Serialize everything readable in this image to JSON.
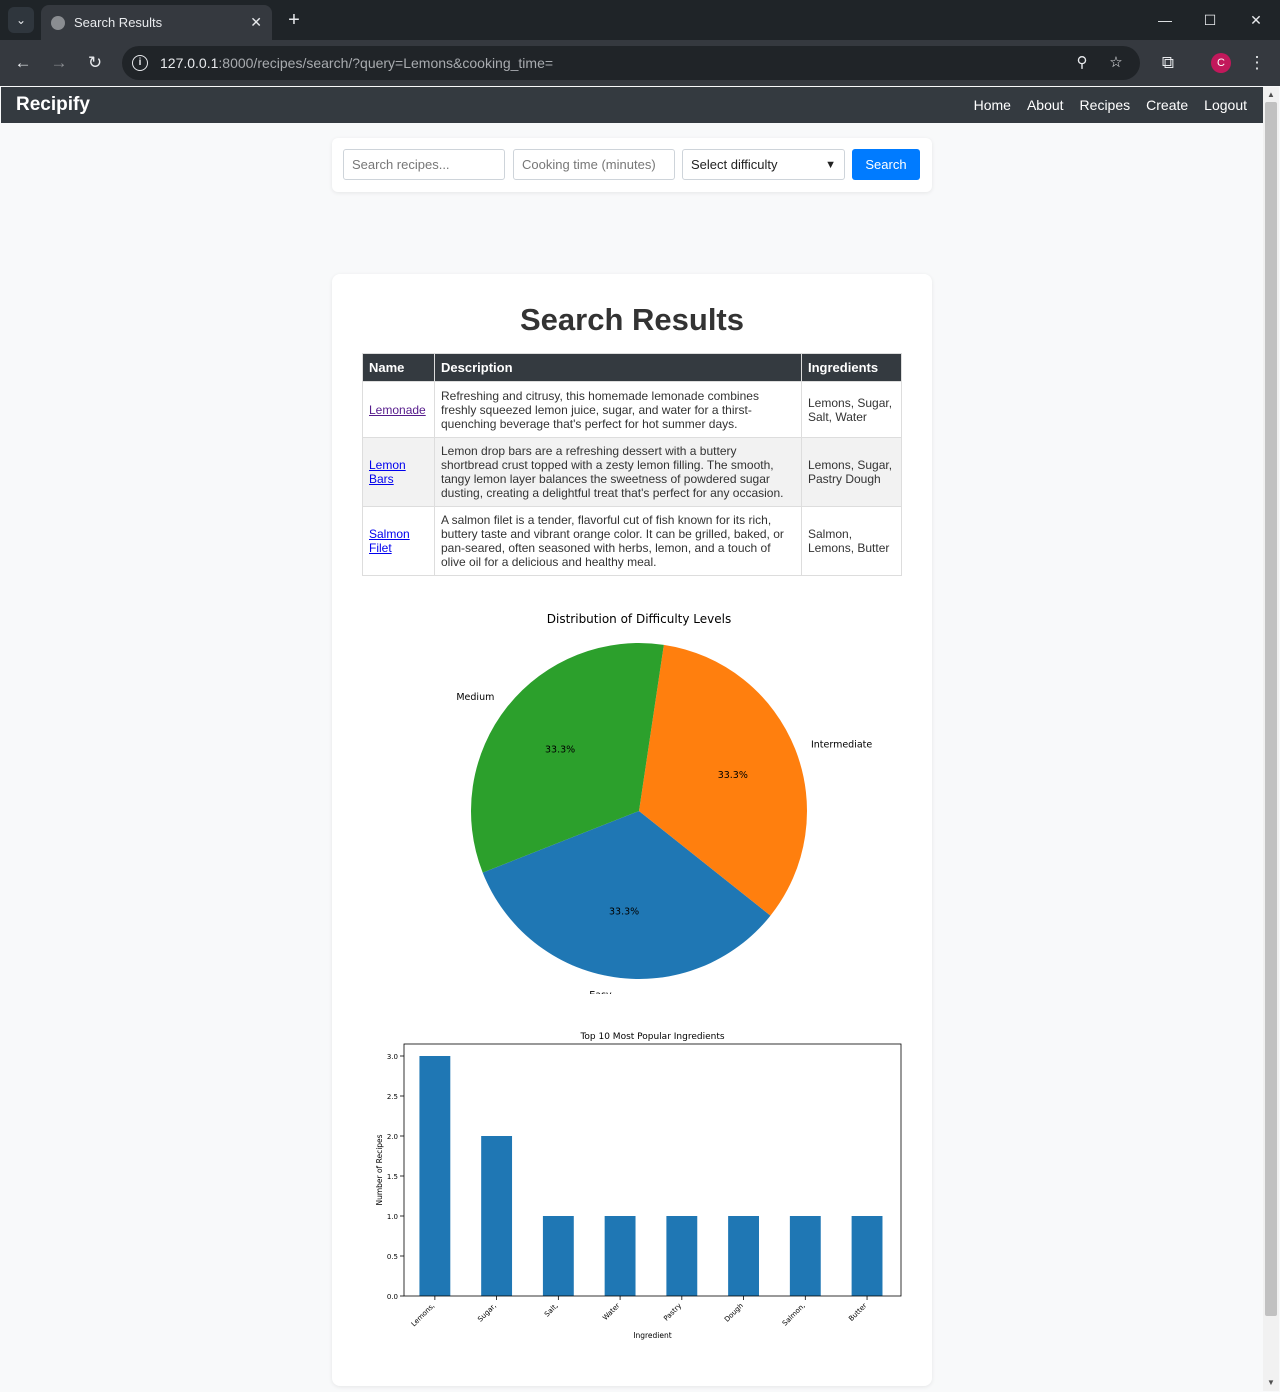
{
  "browser": {
    "tab_title": "Search Results",
    "url_host": "127.0.0.1",
    "url_rest": ":8000/recipes/search/?query=Lemons&cooking_time=",
    "profile_initial": "C"
  },
  "site": {
    "brand": "Recipify",
    "nav": [
      "Home",
      "About",
      "Recipes",
      "Create",
      "Logout"
    ]
  },
  "search": {
    "query_placeholder": "Search recipes...",
    "time_placeholder": "Cooking time (minutes)",
    "difficulty_selected": "Select difficulty",
    "button": "Search"
  },
  "results": {
    "heading": "Search Results",
    "columns": [
      "Name",
      "Description",
      "Ingredients"
    ],
    "rows": [
      {
        "name": "Lemonade",
        "description": "Refreshing and citrusy, this homemade lemonade combines freshly squeezed lemon juice, sugar, and water for a thirst-quenching beverage that's perfect for hot summer days.",
        "ingredients": "Lemons, Sugar, Salt, Water"
      },
      {
        "name": "Lemon Bars",
        "description": "Lemon drop bars are a refreshing dessert with a buttery shortbread crust topped with a zesty lemon filling. The smooth, tangy lemon layer balances the sweetness of powdered sugar dusting, creating a delightful treat that's perfect for any occasion.",
        "ingredients": "Lemons, Sugar, Pastry Dough"
      },
      {
        "name": "Salmon Filet",
        "description": "A salmon filet is a tender, flavorful cut of fish known for its rich, buttery taste and vibrant orange color. It can be grilled, baked, or pan-seared, often seasoned with herbs, lemon, and a touch of olive oil for a delicious and healthy meal.",
        "ingredients": "Salmon, Lemons, Butter"
      }
    ]
  },
  "chart_data": [
    {
      "type": "pie",
      "title": "Distribution of Difficulty Levels",
      "slices": [
        {
          "label": "Easy",
          "value": 33.3,
          "pct_label": "33.3%",
          "color": "#1f77b4"
        },
        {
          "label": "Intermediate",
          "value": 33.3,
          "pct_label": "33.3%",
          "color": "#ff7f0e"
        },
        {
          "label": "Medium",
          "value": 33.3,
          "pct_label": "33.3%",
          "color": "#2ca02c"
        }
      ]
    },
    {
      "type": "bar",
      "title": "Top 10 Most Popular Ingredients",
      "xlabel": "Ingredient",
      "ylabel": "Number of Recipes",
      "categories": [
        "Lemons,",
        "Sugar,",
        "Salt,",
        "Water",
        "Pastry",
        "Dough",
        "Salmon,",
        "Butter"
      ],
      "values": [
        3,
        2,
        1,
        1,
        1,
        1,
        1,
        1
      ],
      "ylim": [
        0,
        3.15
      ],
      "yticks": [
        "0.0",
        "0.5",
        "1.0",
        "1.5",
        "2.0",
        "2.5",
        "3.0"
      ],
      "color": "#1f77b4"
    }
  ]
}
